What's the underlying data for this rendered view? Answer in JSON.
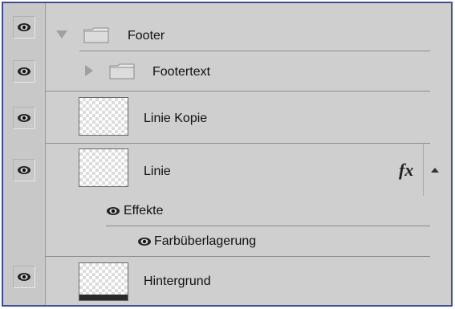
{
  "layers": [
    {
      "label": "Footer",
      "visible": true,
      "kind": "group",
      "expanded": true,
      "icon": "folder-icon",
      "disclosure_icon": "chevron-down-icon"
    },
    {
      "label": "Footertext",
      "visible": true,
      "kind": "group",
      "expanded": false,
      "icon": "folder-icon",
      "disclosure_icon": "chevron-right-icon"
    },
    {
      "label": "Linie Kopie",
      "visible": true,
      "kind": "layer",
      "icon": "transparent-thumbnail"
    },
    {
      "label": "Linie",
      "visible": true,
      "kind": "layer",
      "icon": "transparent-thumbnail",
      "fx_label": "fx",
      "fx_icon": "fx-icon"
    },
    {
      "label": "Effekte",
      "visible": true,
      "kind": "effects-header"
    },
    {
      "label": "Farbüberlagerung",
      "visible": true,
      "kind": "effect"
    },
    {
      "label": "Hintergrund",
      "visible": true,
      "kind": "layer",
      "icon": "background-thumbnail"
    }
  ],
  "colors": {
    "panel_background": "#cfcfcf",
    "panel_border": "#3d4f8f",
    "separator": "#8c8c8c"
  },
  "icons": {
    "visibility": "eye-icon",
    "expand_effects": "chevron-up-icon"
  }
}
